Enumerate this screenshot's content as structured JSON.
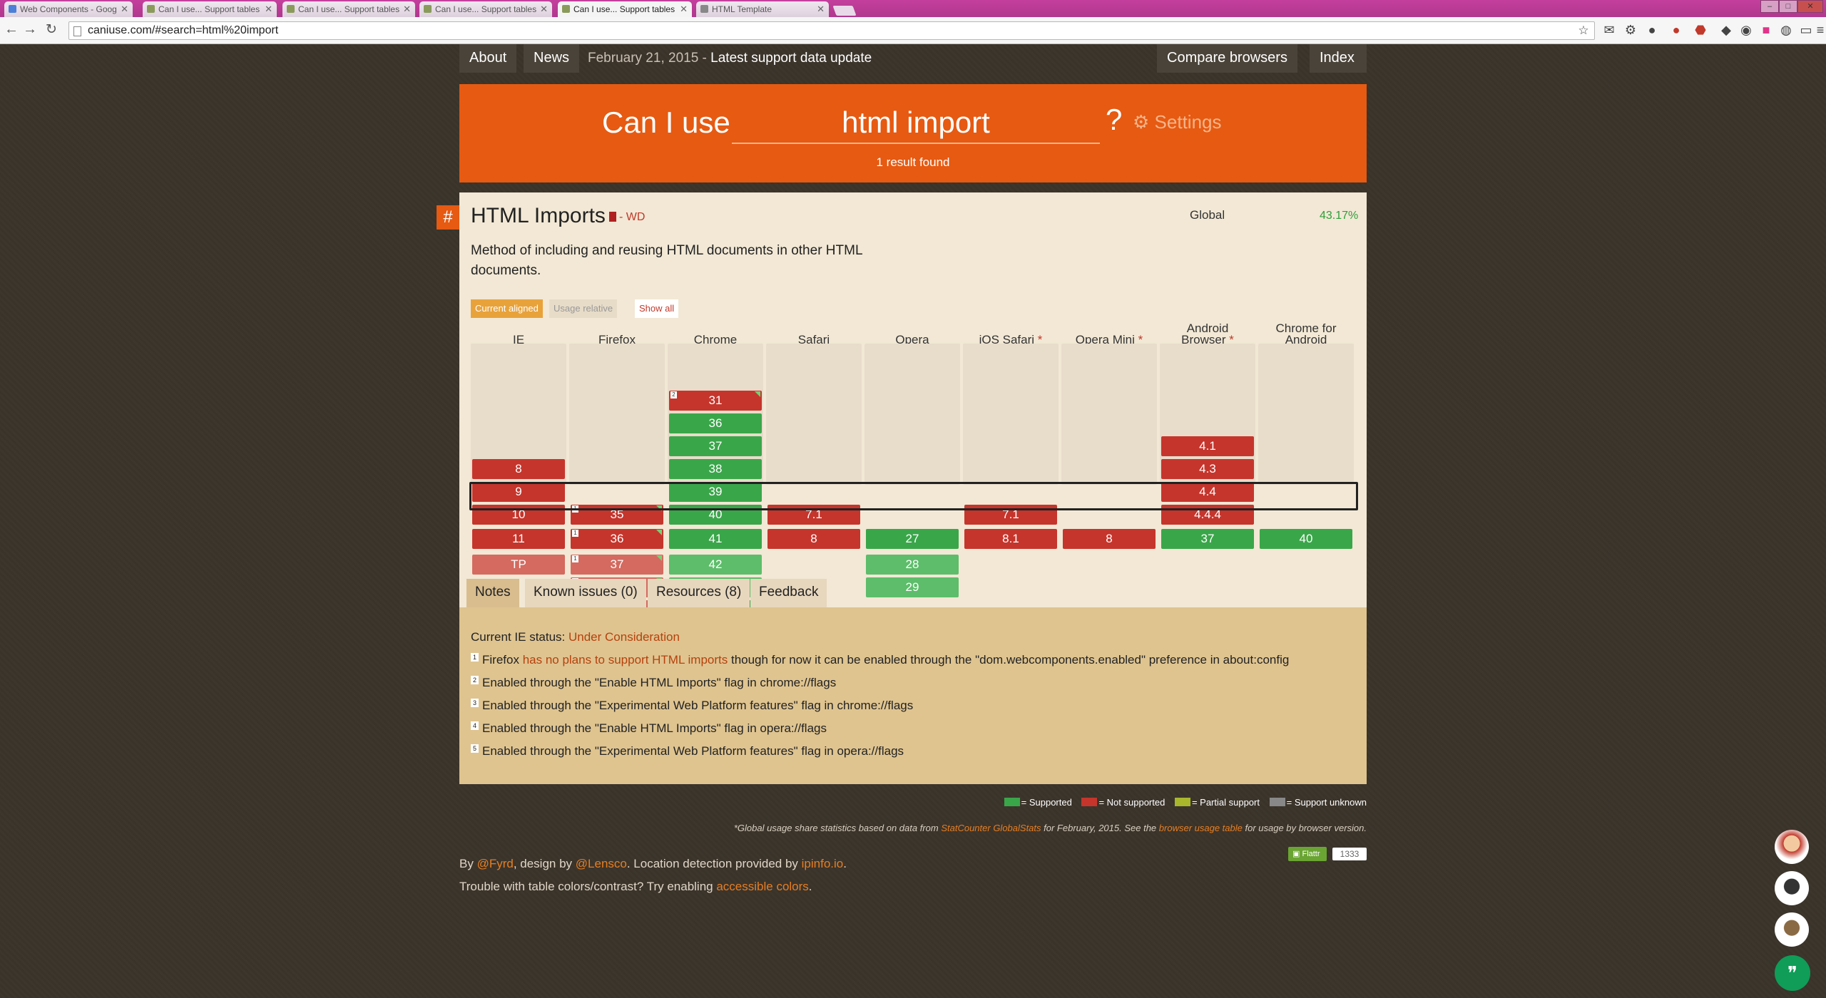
{
  "browser": {
    "tabs": [
      {
        "title": "Web Components - Goog",
        "fav": "#4c7fd8"
      },
      {
        "title": "Can I use... Support tables",
        "fav": "#8a9a5b"
      },
      {
        "title": "Can I use... Support tables",
        "fav": "#8a9a5b"
      },
      {
        "title": "Can I use... Support tables",
        "fav": "#8a9a5b"
      },
      {
        "title": "Can I use... Support tables",
        "fav": "#8a9a5b",
        "active": true
      },
      {
        "title": "HTML Template",
        "fav": "#888888"
      }
    ],
    "url": "caniuse.com/#search=html%20import"
  },
  "nav": {
    "about": "About",
    "news": "News",
    "date": "February 21, 2015",
    "dash": " - ",
    "update": "Latest support data update",
    "compare": "Compare browsers",
    "index": "Index"
  },
  "search": {
    "label": "Can I use",
    "query": "html import",
    "qmark": "?",
    "settings": "Settings",
    "results": "1 result found"
  },
  "feature": {
    "hash": "#",
    "title": "HTML Imports",
    "status": "- WD",
    "global_label": "Global",
    "global_value": "43.17%",
    "description": "Method of including and reusing HTML documents in other HTML documents.",
    "view_current": "Current aligned",
    "view_usage": "Usage relative",
    "show_all": "Show all"
  },
  "browsers": [
    {
      "name": "IE",
      "color": "#3a7bd5"
    },
    {
      "name": "Firefox",
      "color": "#d35400"
    },
    {
      "name": "Chrome",
      "color": "#3a7bd5"
    },
    {
      "name": "Safari",
      "color": "#888888"
    },
    {
      "name": "Opera",
      "color": "#b03030"
    },
    {
      "name": "iOS Safari",
      "color": "#888888",
      "ast": "*"
    },
    {
      "name": "Opera Mini",
      "color": "#b03030",
      "ast": "*"
    },
    {
      "name": "Android Browser",
      "color": "#6aa432",
      "ast": "*"
    },
    {
      "name": "Chrome for Android",
      "color": "#3a7bd5"
    }
  ],
  "notes_tabs": [
    "Notes",
    "Known issues (0)",
    "Resources (8)",
    "Feedback"
  ],
  "notes": {
    "ie_status_label": "Current IE status: ",
    "ie_status": "Under Consideration",
    "n1_a": "Firefox ",
    "n1_link": "has no plans to support HTML imports",
    "n1_b": " though for now it can be enabled through the \"dom.webcomponents.enabled\" preference in about:config",
    "n2": "Enabled through the \"Enable HTML Imports\" flag in chrome://flags",
    "n3": "Enabled through the \"Experimental Web Platform features\" flag in chrome://flags",
    "n4": "Enabled through the \"Enable HTML Imports\" flag in opera://flags",
    "n5": "Enabled through the \"Experimental Web Platform features\" flag in opera://flags"
  },
  "legend": {
    "supported": "= Supported",
    "not_supported": "= Not supported",
    "partial": "= Partial support",
    "unknown": "= Support unknown",
    "colors": {
      "supported": "#3aa64a",
      "not_supported": "#c5352c",
      "partial": "#a8b72b",
      "unknown": "#888888"
    }
  },
  "stats": {
    "a": "*Global usage share statistics based on data from ",
    "link1": "StatCounter GlobalStats",
    "b": " for February, 2015. See the ",
    "link2": "browser usage table",
    "c": " for usage by browser version."
  },
  "flattr": {
    "label": "Flattr",
    "count": "1333"
  },
  "footer": {
    "by": "By ",
    "fyrd": "@Fyrd",
    "design": ", design by ",
    "lensco": "@Lensco",
    "loc": ". Location detection provided by ",
    "ipinfo": "ipinfo.io",
    "dot": ".",
    "trouble": "Trouble with table colors/contrast? Try enabling ",
    "accessible": "accessible colors",
    "dot2": "."
  }
}
